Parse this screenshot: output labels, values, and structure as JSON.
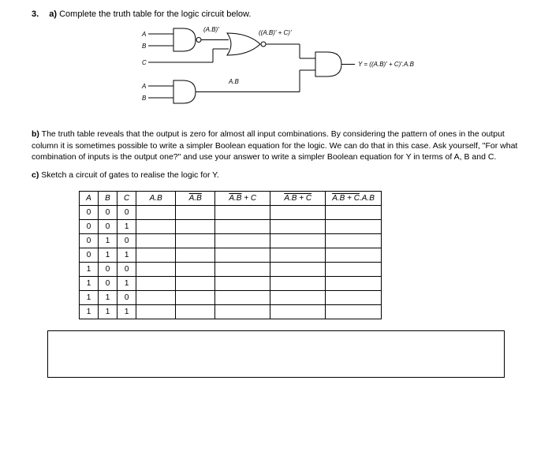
{
  "question": {
    "number": "3.",
    "part_a_label": "a)",
    "part_a_text": "Complete the truth table for the logic circuit below.",
    "part_b_label": "b)",
    "part_b_text": "The truth table reveals that the output is zero for almost all input combinations. By considering the pattern of ones in the output column it is sometimes possible to write a simpler Boolean equation for the logic. We can do that in this case. Ask yourself, \"For what combination of inputs is the output one?\" and use your answer to write a simpler Boolean equation for Y in terms of A, B and C.",
    "part_c_label": "c)",
    "part_c_text": "Sketch a circuit of gates to realise the logic for Y."
  },
  "circuit": {
    "inputs": {
      "a1": "A",
      "b1": "B",
      "c": "C",
      "a2": "A",
      "b2": "B"
    },
    "labels": {
      "nand1": "(A.B)'",
      "or1": "(A.B)' + C)'",
      "and2": "A.B",
      "output": "Y = ((A.B)' + C)'.A.B"
    }
  },
  "table": {
    "headers": [
      "A",
      "B",
      "C",
      "A.B",
      "A.B",
      "A.B + C",
      "A.B + C",
      "A.B + C.A.B"
    ],
    "rows": [
      [
        "0",
        "0",
        "0",
        "",
        "",
        "",
        "",
        ""
      ],
      [
        "0",
        "0",
        "1",
        "",
        "",
        "",
        "",
        ""
      ],
      [
        "0",
        "1",
        "0",
        "",
        "",
        "",
        "",
        ""
      ],
      [
        "0",
        "1",
        "1",
        "",
        "",
        "",
        "",
        ""
      ],
      [
        "1",
        "0",
        "0",
        "",
        "",
        "",
        "",
        ""
      ],
      [
        "1",
        "0",
        "1",
        "",
        "",
        "",
        "",
        ""
      ],
      [
        "1",
        "1",
        "0",
        "",
        "",
        "",
        "",
        ""
      ],
      [
        "1",
        "1",
        "1",
        "",
        "",
        "",
        "",
        ""
      ]
    ]
  }
}
